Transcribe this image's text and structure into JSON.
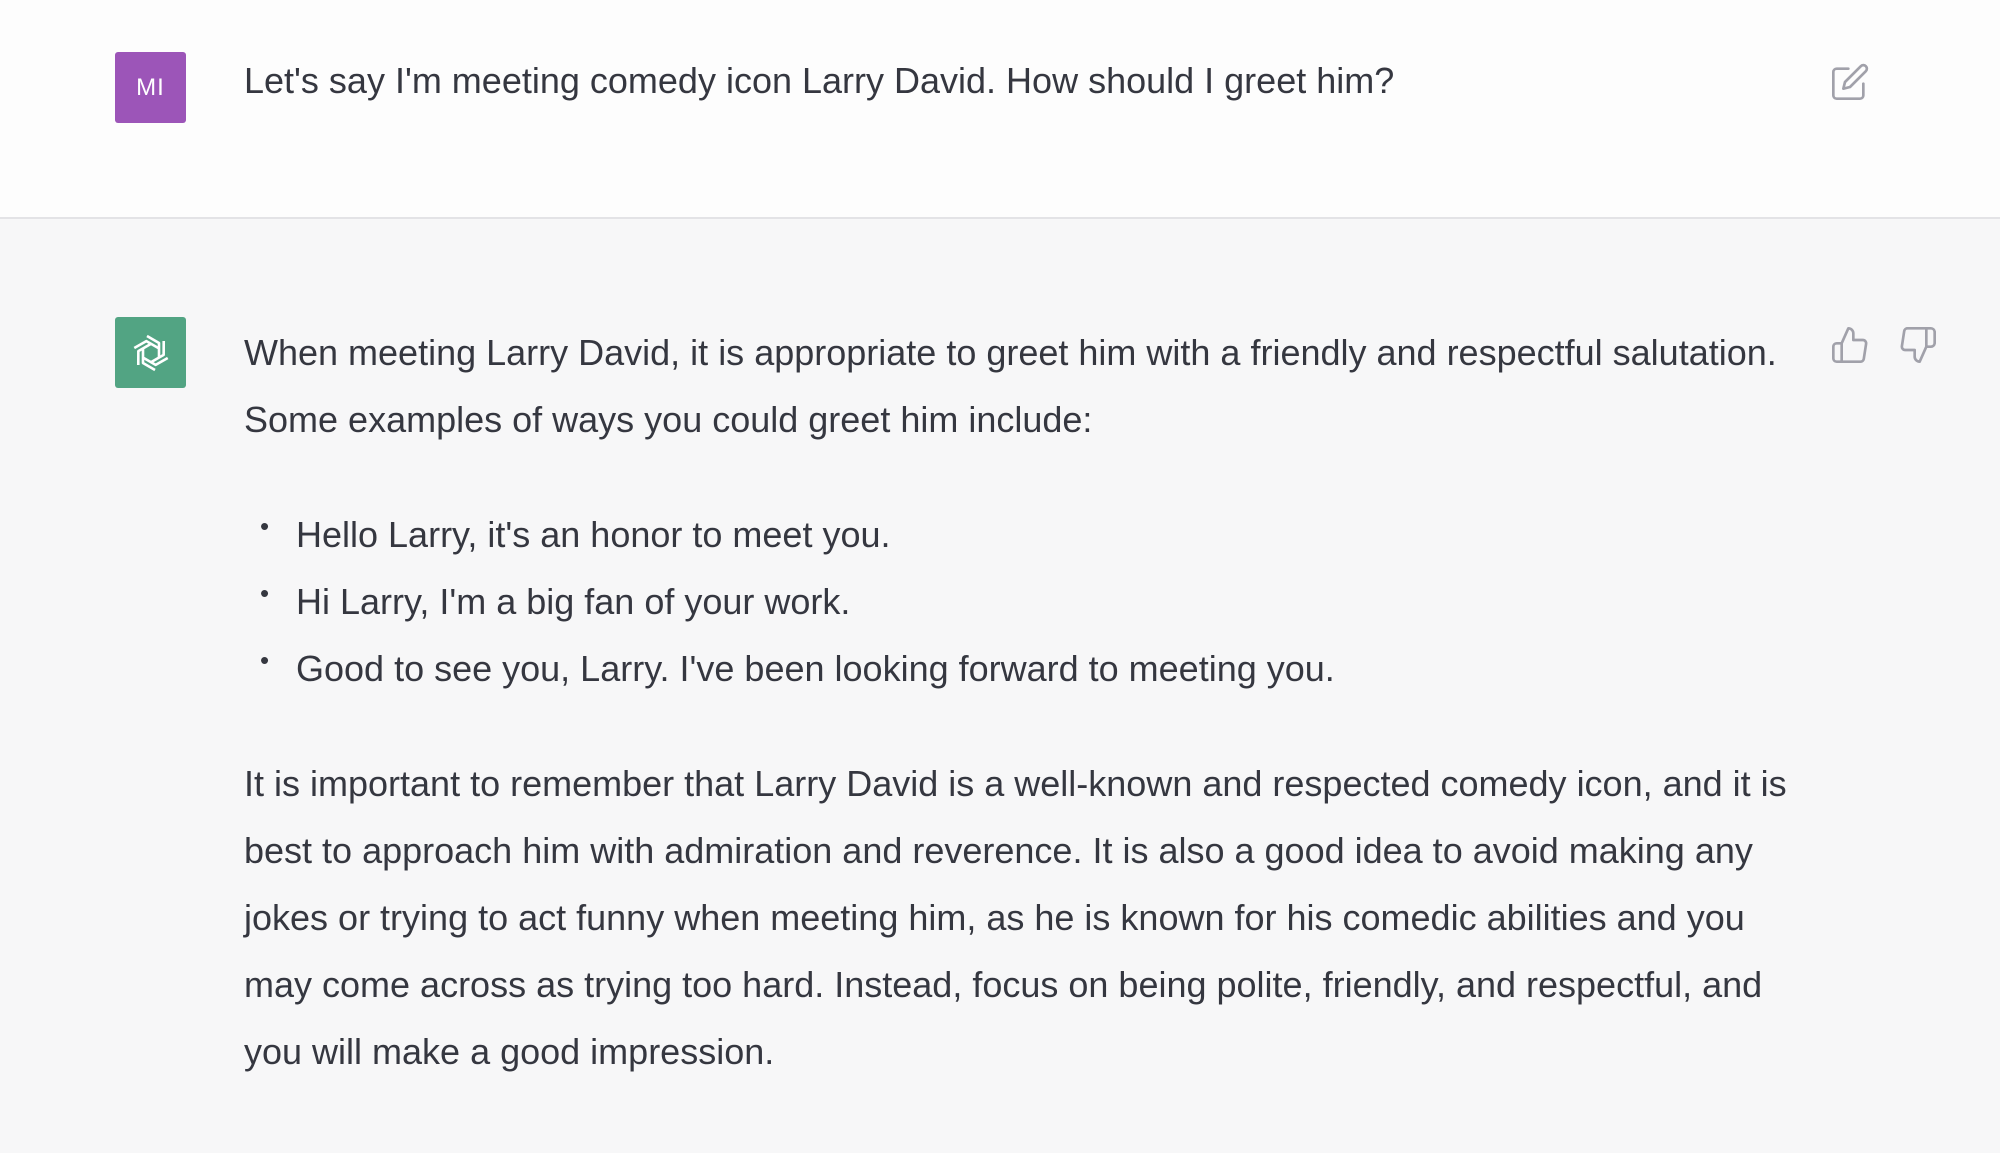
{
  "user": {
    "avatar_initials": "MI",
    "message": "Let's say I'm meeting comedy icon Larry David. How should I greet him?",
    "avatar_color": "#9c55b8",
    "edit_icon": "edit-icon"
  },
  "assistant": {
    "avatar_icon": "openai-logo-icon",
    "avatar_color": "#52a483",
    "intro": "When meeting Larry David, it is appropriate to greet him with a friendly and respectful salutation. Some examples of ways you could greet him include:",
    "bullets": [
      "Hello Larry, it's an honor to meet you.",
      "Hi Larry, I'm a big fan of your work.",
      "Good to see you, Larry. I've been looking forward to meeting you."
    ],
    "closing": "It is important to remember that Larry David is a well-known and respected comedy icon, and it is best to approach him with admiration and reverence. It is also a good idea to avoid making any jokes or trying to act funny when meeting him, as he is known for his comedic abilities and you may come across as trying too hard. Instead, focus on being polite, friendly, and respectful, and you will make a good impression.",
    "feedback_icons": [
      "thumbs-up-icon",
      "thumbs-down-icon"
    ]
  }
}
